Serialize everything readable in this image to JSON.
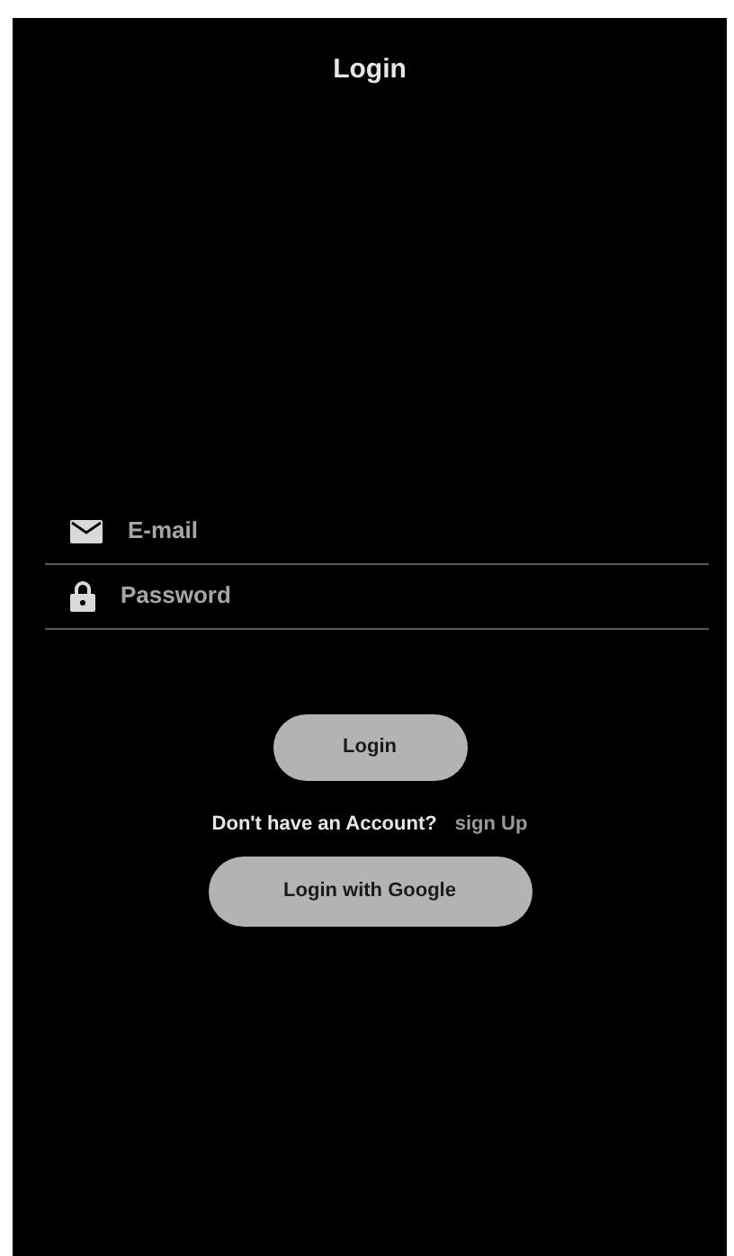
{
  "title": "Login",
  "fields": [
    {
      "kind": "email",
      "placeholder": "E-mail"
    },
    {
      "kind": "password",
      "placeholder": "Password"
    }
  ],
  "login_button": "Login",
  "signup_prompt": "Don't have an Account?",
  "signup_link": "sign Up",
  "google_button": "Login with Google"
}
